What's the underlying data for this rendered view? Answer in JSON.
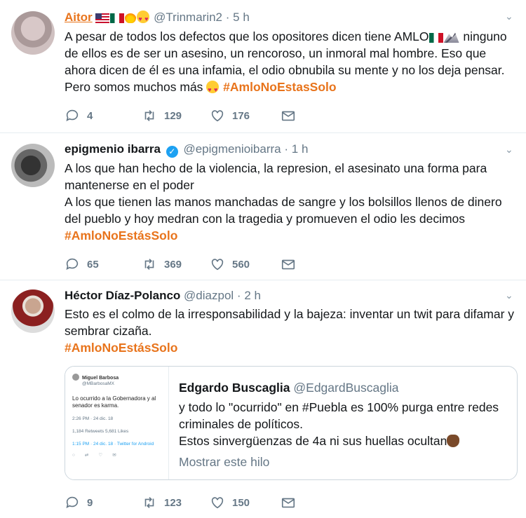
{
  "tweets": [
    {
      "name": "Aitor",
      "handle": "@Trinmarin2",
      "time": "5 h",
      "text_a": "A pesar de todos los defectos que los opositores dicen tiene AMLO",
      "text_b": " ninguno de ellos es de ser un asesino, un rencoroso, un inmoral mal hombre. Eso que ahora dicen de él es una infamia, el odio obnubila su mente y no los deja pensar. Pero somos muchos más ",
      "hashtag": "#AmloNoEstasSolo",
      "replies": "4",
      "retweets": "129",
      "likes": "176"
    },
    {
      "name": "epigmenio ibarra",
      "handle": "@epigmenioibarra",
      "time": "1 h",
      "text_1": "A los que han hecho de la violencia, la represion, el asesinato una forma para mantenerse en el poder",
      "text_2": "A los que tienen las manos manchadas de sangre y los bolsillos llenos de dinero del pueblo y hoy medran con la tragedia y promueven el odio les decimos",
      "hashtag": "#AmloNoEstásSolo",
      "replies": "65",
      "retweets": "369",
      "likes": "560"
    },
    {
      "name": "Héctor Díaz-Polanco",
      "handle": "@diazpol",
      "time": "2 h",
      "text": "Esto es el colmo de la irresponsabilidad y la bajeza: inventar un twit para difamar y sembrar cizaña.",
      "hashtag": "#AmloNoEstásSolo",
      "replies": "9",
      "retweets": "123",
      "likes": "150",
      "quote": {
        "name": "Edgardo Buscaglia",
        "handle": "@EdgardBuscaglia",
        "line_1": "y todo lo \"ocurrido\" en #Puebla es 100% purga entre redes criminales de políticos.",
        "line_2": "Estos sinvergüenzas de 4a ni sus huellas ocultan",
        "show_thread": "Mostrar este hilo",
        "thumb_name": "Miguel Barbosa",
        "thumb_handle": "@MBarbosaMX",
        "thumb_text": "Lo ocurrido a la Gobernadora y al senador es karma.",
        "thumb_time": "2:26 PM · 24 dic. 18",
        "thumb_stats": "1,184 Retweets   5,681 Likes",
        "thumb_source": "1:15 PM · 24 dic. 18 · Twitter for Android"
      }
    }
  ],
  "dot": "·"
}
